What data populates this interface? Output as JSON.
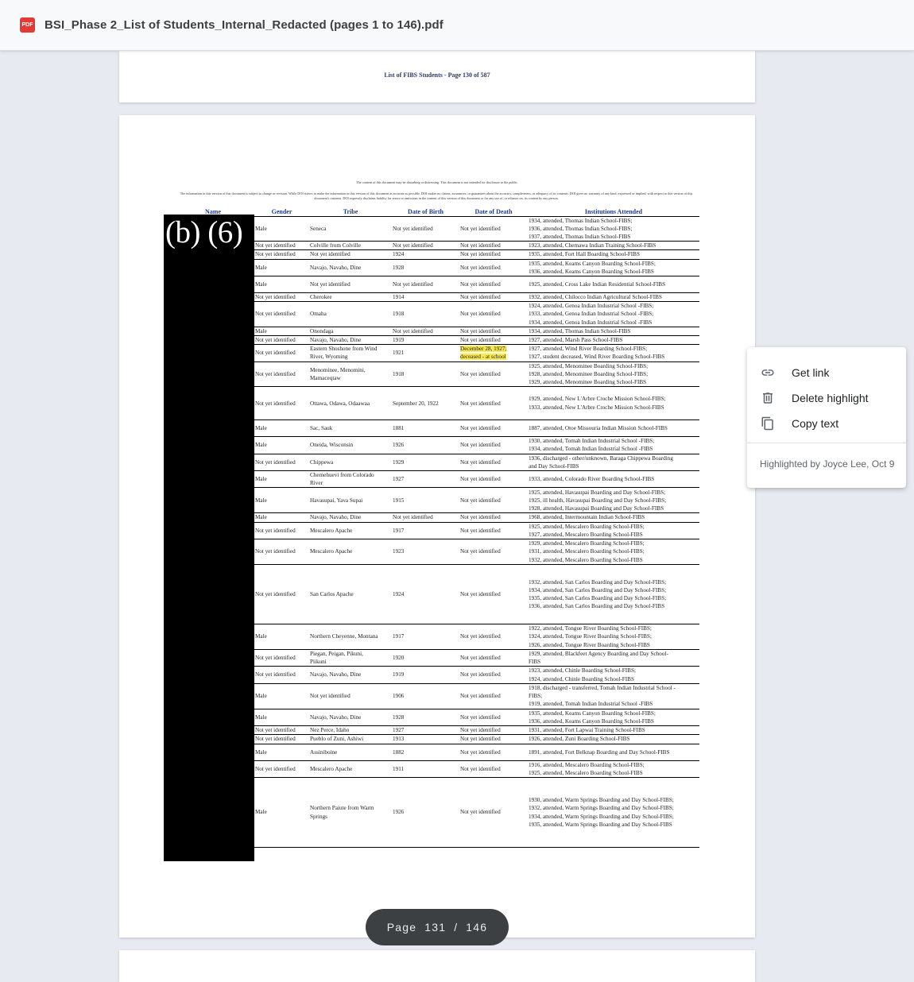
{
  "app": {
    "file_badge": "PDF",
    "title": "BSI_Phase 2_List of Students_Internal_Redacted (pages 1 to 146).pdf"
  },
  "prev_page": {
    "footer": "List of FIBS Students - Page 130 of 587"
  },
  "current_page": {
    "disclaimer_line1": "The content of this document may be disturbing or distressing. This document is not intended for disclosure to the public.",
    "disclaimer_line2": "The information in this version of this document is subject to change or revision. While DOI strives to make the information in this version of this document as accurate as possible, DOI makes no claims, assurances, or guarantees about the accuracy, completeness, or adequacy of its contents. DOI gives no warranty of any kind, expressed or implied, with respect to this version of this document's contents. DOI expressly disclaims liability for errors or omissions in the content of this version of this document or for any use of, or reliance on, its content by any person.",
    "redaction_label": "(b) (6)",
    "columns": [
      "Name",
      "Gender",
      "Tribe",
      "Date of Birth",
      "Date of Death",
      "Institutions Attended"
    ],
    "rows": [
      {
        "gender": "Male",
        "tribe": "Seneca",
        "dob": "Not yet identified",
        "dod": "Not yet identified",
        "institutions": "1934, attended, Thomas Indian School-FIBS;\n1936, attended, Thomas Indian School-FIBS;\n1937, attended, Thomas Indian School-FIBS"
      },
      {
        "gender": "Not yet identified",
        "tribe": "Colville from Colville",
        "dob": "Not yet identified",
        "dod": "Not yet identified",
        "institutions": "1923, attended, Chemawa Indian Training School-FIBS"
      },
      {
        "gender": "Not yet identified",
        "tribe": "Not yet identified",
        "dob": "1924",
        "dod": "Not yet identified",
        "institutions": "1935, attended, Fort Hall Boarding School-FIBS"
      },
      {
        "gender": "Male",
        "tribe": "Navajo, Navaho, Dine",
        "dob": "1928",
        "dod": "Not yet identified",
        "institutions": "1935, attended, Keams Canyon Boarding School-FIBS;\n1936, attended, Keams Canyon Boarding School-FIBS"
      },
      {
        "gender": "Male",
        "tribe": "Not yet identified",
        "dob": "Not yet identified",
        "dod": "Not yet identified",
        "institutions": "1925, attended, Cross Lake Indian Residential School-FIBS"
      },
      {
        "gender": "Not yet identified",
        "tribe": "Cherokee",
        "dob": "1914",
        "dod": "Not yet identified",
        "institutions": "1932, attended, Chilocco Indian Agricultural School-FIBS"
      },
      {
        "gender": "Not yet identified",
        "tribe": "Omaha",
        "dob": "1918",
        "dod": "Not yet identified",
        "institutions": "1924, attended, Genoa Indian Industrial School -FIBS;\n1933, attended, Genoa Indian Industrial School -FIBS;\n1934, attended, Genoa Indian Industrial School -FIBS"
      },
      {
        "gender": "Male",
        "tribe": "Onondaga",
        "dob": "Not yet identified",
        "dod": "Not yet identified",
        "institutions": "1934, attended, Thomas Indian School-FIBS"
      },
      {
        "gender": "Not yet identified",
        "tribe": "Navajo, Navaho, Dine",
        "dob": "1919",
        "dod": "Not yet identified",
        "institutions": "1927, attended, Marsh Pass School-FIBS"
      },
      {
        "gender": "Not yet identified",
        "tribe": "Eastern Shoshone from Wind\nRiver, Wyoming",
        "dob": "1921",
        "dod": "December 28, 1927;\ndeceased - at school",
        "highlight": true,
        "institutions": "1927, attended, Wind River Boarding School-FIBS;\n1927, student deceased, Wind River Boarding School-FIBS"
      },
      {
        "gender": "Not yet identified",
        "tribe": "Menominee, Menomini,\nMamaceqtaw",
        "dob": "1918",
        "dod": "Not yet identified",
        "institutions": "1925, attended, Menominee Boarding School-FIBS;\n1928, attended, Menominee Boarding School-FIBS;\n1929, attended, Menominee Boarding School-FIBS"
      },
      {
        "gender": "Not yet identified",
        "tribe": "Ottawa, Odawa, Odaawaa",
        "dob": "September 20, 1922",
        "dod": "Not yet identified",
        "institutions": "1929, attended, New L'Arbre Croche Mission School-FIBS;\n1933, attended, New L'Arbre Croche Mission School-FIBS"
      },
      {
        "gender": "Male",
        "tribe": "Sac, Sauk",
        "dob": "1881",
        "dod": "Not yet identified",
        "institutions": "1887, attended, Otoe Missouria Indian Mission School-FIBS"
      },
      {
        "gender": "Male",
        "tribe": "Oneida, Wisconsin",
        "dob": "1926",
        "dod": "Not yet identified",
        "institutions": "1930, attended, Tomah Indian Industrial School -FIBS;\n1934, attended, Tomah Indian Industrial School -FIBS"
      },
      {
        "gender": "Not yet identified",
        "tribe": "Chippewa",
        "dob": "1929",
        "dod": "Not yet identified",
        "institutions": "1936, discharged - other/unknown, Baraga Chippewa Boarding\nand Day School-FIBS"
      },
      {
        "gender": "Male",
        "tribe": "Chemehuevi from Colorado\nRiver",
        "dob": "1927",
        "dod": "Not yet identified",
        "institutions": "1933, attended, Colorado River Boarding School-FIBS"
      },
      {
        "gender": "Male",
        "tribe": "Havasupai, Yava Supai",
        "dob": "1915",
        "dod": "Not yet identified",
        "institutions": "1925, attended, Havasupai Boarding and Day School-FIBS;\n1925, ill health, Havasupai Boarding and Day School-FIBS;\n1928, attended, Havasupai Boarding and Day School-FIBS"
      },
      {
        "gender": "Male",
        "tribe": "Navajo, Navaho, Dine",
        "dob": "Not yet identified",
        "dod": "Not yet identified",
        "institutions": "1968, attended, Intermountain Indian School-FIBS"
      },
      {
        "gender": "Not yet identified",
        "tribe": "Mescalero Apache",
        "dob": "1917",
        "dod": "Not yet identified",
        "institutions": "1925, attended, Mescalero Boarding School-FIBS;\n1927, attended, Mescalero Boarding School-FIBS"
      },
      {
        "gender": "Not yet identified",
        "tribe": "Mescalero Apache",
        "dob": "1923",
        "dod": "Not yet identified",
        "institutions": "1929, attended, Mescalero Boarding School-FIBS;\n1931, attended, Mescalero Boarding School-FIBS;\n1932, attended, Mescalero Boarding School-FIBS"
      },
      {
        "gender": "Not yet identified",
        "tribe": "San Carlos Apache",
        "dob": "1924",
        "dod": "Not yet identified",
        "institutions": "1932, attended, San Carlos Boarding and Day School-FIBS;\n1934, attended, San Carlos Boarding and Day School-FIBS;\n1935, attended, San Carlos Boarding and Day School-FIBS;\n1936, attended, San Carlos Boarding and Day School-FIBS"
      },
      {
        "gender": "Male",
        "tribe": "Northern Cheyenne, Montana",
        "dob": "1917",
        "dod": "Not yet identified",
        "institutions": "1922, attended, Tongue River Boarding School-FIBS;\n1924, attended, Tongue River Boarding School-FIBS;\n1926, attended, Tongue River Boarding School-FIBS"
      },
      {
        "gender": "Not yet identified",
        "tribe": "Piegan, Peigan, Pikuni,\nPiikuni",
        "dob": "1920",
        "dod": "Not yet identified",
        "institutions": "1929, attended, Blackfeet Agency Boarding and Day School-\nFIBS"
      },
      {
        "gender": "Not yet identified",
        "tribe": "Navajo, Navaho, Dine",
        "dob": "1919",
        "dod": "Not yet identified",
        "institutions": "1923, attended, Chinle Boarding School-FIBS;\n1924, attended, Chinle Boarding School-FIBS"
      },
      {
        "gender": "Male",
        "tribe": "Not yet identified",
        "dob": "1906",
        "dod": "Not yet identified",
        "institutions": "1918, discharged - transferred, Tomah Indian Industrial School -\nFIBS;\n1919, attended, Tomah Indian Industrial School -FIBS"
      },
      {
        "gender": "Male",
        "tribe": "Navajo, Navaho, Dine",
        "dob": "1928",
        "dod": "Not yet identified",
        "institutions": "1935, attended, Keams Canyon Boarding School-FIBS;\n1936, attended, Keams Canyon Boarding School-FIBS"
      },
      {
        "gender": "Not yet identified",
        "tribe": "Nez Perce, Idaho",
        "dob": "1927",
        "dod": "Not yet identified",
        "institutions": "1931, attended, Fort Lapwai Training School-FIBS"
      },
      {
        "gender": "Not yet identified",
        "tribe": "Pueblo of Zuni, Ashiwi",
        "dob": "1913",
        "dod": "Not yet identified",
        "institutions": "1926, attended, Zuni Boarding School-FIBS"
      },
      {
        "gender": "Male",
        "tribe": "Assiniboine",
        "dob": "1882",
        "dod": "Not yet identified",
        "institutions": "1891, attended, Fort Belknap Boarding and Day School-FIBS"
      },
      {
        "gender": "Not yet identified",
        "tribe": "Mescalero Apache",
        "dob": "1911",
        "dod": "Not yet identified",
        "institutions": "1916, attended, Mescalero Boarding School-FIBS;\n1925, attended, Mescalero Boarding School-FIBS"
      },
      {
        "gender": "Male",
        "tribe": "Northern Paiute from Warm\nSprings",
        "dob": "1926",
        "dod": "Not yet identified",
        "institutions": "1930, attended, Warm Springs Boarding and Day School-FIBS;\n1932, attended, Warm Springs Boarding and Day School-FIBS;\n1934, attended, Warm Springs Boarding and Day School-FIBS;\n1935, attended, Warm Springs Boarding and Day School-FIBS"
      }
    ]
  },
  "context_menu": {
    "items": [
      {
        "icon": "link-icon",
        "label": "Get link"
      },
      {
        "icon": "trash-icon",
        "label": "Delete highlight"
      },
      {
        "icon": "copy-icon",
        "label": "Copy text"
      }
    ],
    "meta": "Highlighted by Joyce Lee, Oct 9"
  },
  "page_indicator": {
    "label": "Page",
    "current": "131",
    "separator": "/",
    "total": "146"
  }
}
